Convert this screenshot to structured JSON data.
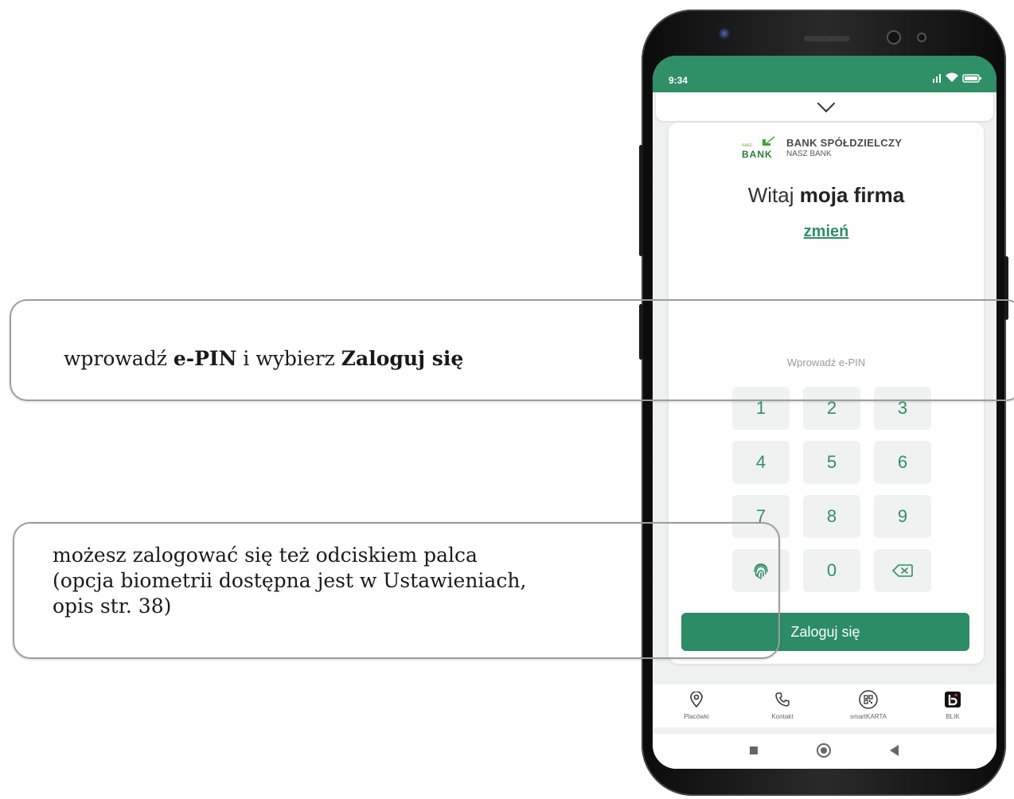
{
  "status_bar": {
    "time": "9:34",
    "indicators": "📶 ᯤ ▭"
  },
  "bank": {
    "logo_small": "nasz",
    "logo_word": "BANK",
    "name": "BANK SPÓŁDZIELCZY",
    "subname": "NASZ BANK"
  },
  "greeting": {
    "prefix": "Witaj",
    "user": "moja firma"
  },
  "change_link": "zmień",
  "pin": {
    "label": "Wprowadź e-PIN"
  },
  "keypad": {
    "keys": [
      "1",
      "2",
      "3",
      "4",
      "5",
      "6",
      "7",
      "8",
      "9",
      "0"
    ],
    "fingerprint_icon": "fingerprint-icon",
    "backspace_icon": "backspace-icon"
  },
  "login_button": "Zaloguj się",
  "bottom_nav": [
    {
      "label": "Placówki",
      "icon": "location-pin-icon"
    },
    {
      "label": "Kontakt",
      "icon": "phone-icon"
    },
    {
      "label": "smartKARTA",
      "icon": "qr-code-icon"
    },
    {
      "label": "BLIK",
      "icon": "blik-icon"
    }
  ],
  "callouts": {
    "epin": {
      "pre": "wprowadź ",
      "b1": "e-PIN",
      "mid": " i wybierz ",
      "b2": "Zaloguj się"
    },
    "fingerprint": {
      "line1": "możesz zalogować się też odciskiem palca",
      "line2": "(opcja biometrii dostępna jest w Ustawieniach,",
      "line3": "opis str. 38)"
    }
  },
  "colors": {
    "brand_green": "#2f8f66",
    "key_bg": "#f0f2f1"
  }
}
